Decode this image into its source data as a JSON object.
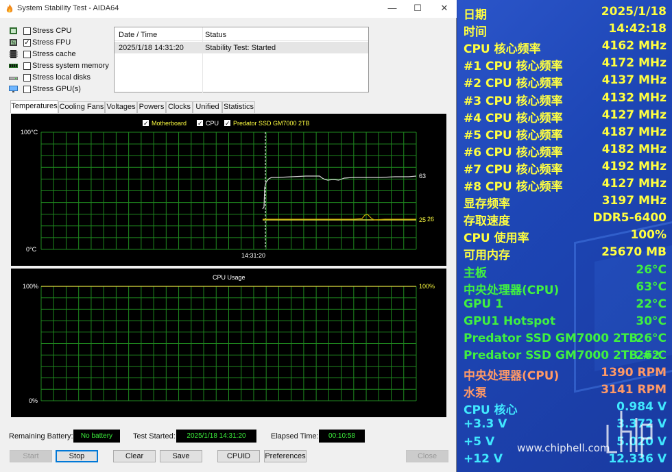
{
  "window": {
    "title": "System Stability Test - AIDA64",
    "min_glyph": "—",
    "max_glyph": "☐",
    "close_glyph": "✕"
  },
  "stress": [
    {
      "label": "Stress CPU",
      "checked": false,
      "icon": "cpu-chip-icon"
    },
    {
      "label": "Stress FPU",
      "checked": true,
      "icon": "fpu-chip-icon"
    },
    {
      "label": "Stress cache",
      "checked": false,
      "icon": "cache-chip-icon"
    },
    {
      "label": "Stress system memory",
      "checked": false,
      "icon": "memory-module-icon"
    },
    {
      "label": "Stress local disks",
      "checked": false,
      "icon": "disk-drive-icon"
    },
    {
      "label": "Stress GPU(s)",
      "checked": false,
      "icon": "gpu-monitor-icon"
    }
  ],
  "log": {
    "col_date": "Date / Time",
    "col_status": "Status",
    "rows": [
      {
        "date": "2025/1/18 14:31:20",
        "status": "Stability Test: Started"
      }
    ]
  },
  "tabs": [
    "Temperatures",
    "Cooling Fans",
    "Voltages",
    "Powers",
    "Clocks",
    "Unified",
    "Statistics"
  ],
  "temp_chart": {
    "legend": [
      {
        "name": "Motherboard",
        "checked": true
      },
      {
        "name": "CPU",
        "checked": true
      },
      {
        "name": "Predator SSD GM7000 2TB",
        "checked": true
      }
    ],
    "y_max_label": "100°C",
    "y_min_label": "0°C",
    "time_label": "14:31:20",
    "value_cpu": "63",
    "value_mb": "25",
    "value_ssd": "26"
  },
  "cpu_chart": {
    "title": "CPU Usage",
    "y_max_label": "100%",
    "y_min_label": "0%",
    "value": "100%"
  },
  "status": {
    "battery_label": "Remaining Battery:",
    "battery_value": "No battery",
    "started_label": "Test Started:",
    "started_value": "2025/1/18 14:31:20",
    "elapsed_label": "Elapsed Time:",
    "elapsed_value": "00:10:58"
  },
  "buttons": {
    "start": "Start",
    "stop": "Stop",
    "clear": "Clear",
    "save": "Save",
    "cpuid": "CPUID",
    "preferences": "Preferences",
    "close": "Close"
  },
  "osd": {
    "colors": {
      "yellow": "#ffff40",
      "green": "#40f040",
      "salmon": "#ff9966",
      "cyan": "#40e8ff"
    },
    "rows": [
      {
        "label": "日期",
        "value": "2025/1/18",
        "color": "yellow"
      },
      {
        "label": "时间",
        "value": "14:42:18",
        "color": "yellow"
      },
      {
        "label": "CPU 核心频率",
        "value": "4162 MHz",
        "color": "yellow"
      },
      {
        "label": "#1 CPU 核心频率",
        "value": "4172 MHz",
        "color": "yellow"
      },
      {
        "label": "#2 CPU 核心频率",
        "value": "4137 MHz",
        "color": "yellow"
      },
      {
        "label": "#3 CPU 核心频率",
        "value": "4132 MHz",
        "color": "yellow"
      },
      {
        "label": "#4 CPU 核心频率",
        "value": "4127 MHz",
        "color": "yellow"
      },
      {
        "label": "#5 CPU 核心频率",
        "value": "4187 MHz",
        "color": "yellow"
      },
      {
        "label": "#6 CPU 核心频率",
        "value": "4182 MHz",
        "color": "yellow"
      },
      {
        "label": "#7 CPU 核心频率",
        "value": "4192 MHz",
        "color": "yellow"
      },
      {
        "label": "#8 CPU 核心频率",
        "value": "4127 MHz",
        "color": "yellow"
      },
      {
        "label": "显存频率",
        "value": "3197 MHz",
        "color": "yellow"
      },
      {
        "label": "存取速度",
        "value": "DDR5-6400",
        "color": "yellow"
      },
      {
        "label": "CPU 使用率",
        "value": "100%",
        "color": "yellow"
      },
      {
        "label": "可用内存",
        "value": "25670 MB",
        "color": "yellow"
      },
      {
        "label": "主板",
        "value": "26°C",
        "color": "green"
      },
      {
        "label": "中央处理器(CPU)",
        "value": "63°C",
        "color": "green"
      },
      {
        "label": "GPU 1",
        "value": "22°C",
        "color": "green"
      },
      {
        "label": "GPU1 Hotspot",
        "value": "30°C",
        "color": "green"
      },
      {
        "label": "Predator SSD GM7000 2TB",
        "value": "26°C",
        "color": "green"
      },
      {
        "label": "Predator SSD GM7000 2TB #2",
        "value": "26°C",
        "color": "green"
      },
      {
        "label": "中央处理器(CPU)",
        "value": "1390 RPM",
        "color": "salmon"
      },
      {
        "label": "水泵",
        "value": "3141 RPM",
        "color": "salmon"
      },
      {
        "label": "CPU 核心",
        "value": "0.984 V",
        "color": "cyan"
      },
      {
        "label": "+3.3 V",
        "value": "3.372 V",
        "color": "cyan"
      },
      {
        "label": "+5 V",
        "value": "5.020 V",
        "color": "cyan"
      },
      {
        "label": "+12 V",
        "value": "12.336 V",
        "color": "cyan"
      }
    ],
    "watermark": "www.chiphell.com"
  }
}
